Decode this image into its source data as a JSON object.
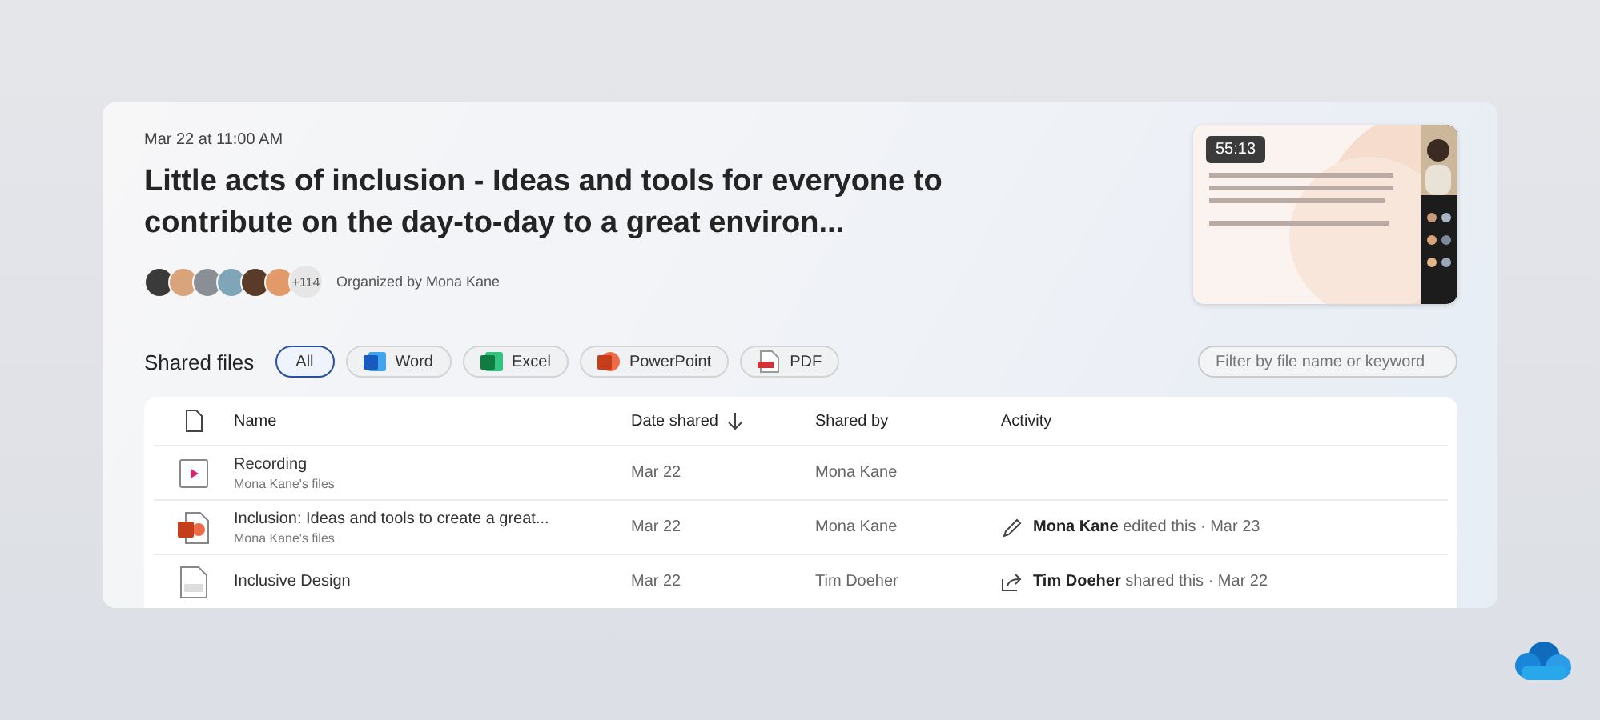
{
  "meeting": {
    "date": "Mar 22 at 11:00 AM",
    "title": "Little acts of inclusion - Ideas and tools for everyone to contribute on the day-to-day to a great environ...",
    "attendees": [
      {
        "color": "#3a3a3a"
      },
      {
        "color": "#d9a47a"
      },
      {
        "color": "#8a8f96"
      },
      {
        "color": "#7fa6b8"
      },
      {
        "color": "#5a3b2a"
      },
      {
        "color": "#e39a6a"
      }
    ],
    "more_count": "+114",
    "organizer": "Organized by Mona Kane",
    "recording": {
      "kind": "picture",
      "duration": "55:13"
    }
  },
  "shared_files": {
    "title": "Shared files",
    "filters": [
      {
        "label": "All",
        "kind": "all",
        "selected": true
      },
      {
        "label": "Word",
        "kind": "word",
        "selected": false
      },
      {
        "label": "Excel",
        "kind": "excel",
        "selected": false
      },
      {
        "label": "PowerPoint",
        "kind": "powerpoint",
        "selected": false
      },
      {
        "label": "PDF",
        "kind": "pdf",
        "selected": false
      }
    ],
    "search": {
      "placeholder": "Filter by file name or keyword"
    },
    "columns": [
      "Name",
      "Date shared",
      "Shared by",
      "Activity"
    ],
    "rows": [
      {
        "kind": "video",
        "name": "Recording",
        "location": "Mona Kane's files",
        "date": "Mar 22",
        "shared_by": "Mona Kane"
      },
      {
        "kind": "powerpoint",
        "name": "Inclusion: Ideas and tools to create a great...",
        "location": "Mona Kane's files",
        "date": "Mar 22",
        "shared_by": "Mona Kane",
        "activity": {
          "kind": "edit",
          "text": "**Mona Kane** edited this · Mar 23"
        }
      },
      {
        "kind": "document",
        "name": "Inclusive Design",
        "date": "Mar 22",
        "shared_by": "Tim Doeher",
        "activity": {
          "kind": "share",
          "text": "**Tim Doeher** shared this · Mar 22"
        }
      }
    ]
  }
}
